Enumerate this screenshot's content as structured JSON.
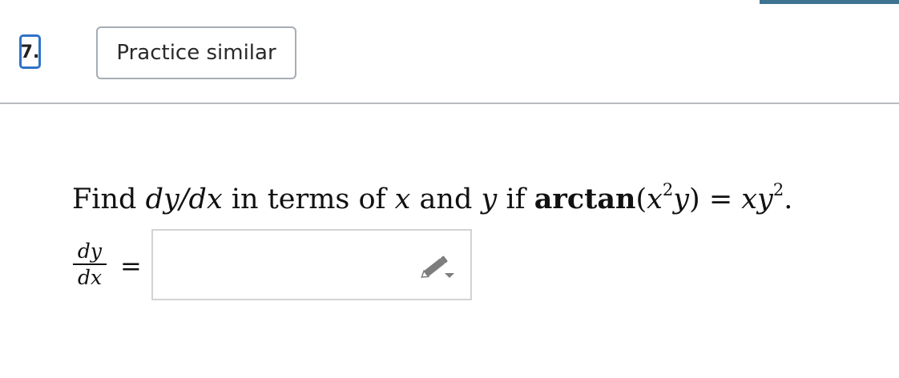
{
  "question_number": "7.",
  "practice_button_label": "Practice similar",
  "question": {
    "text_find": "Find",
    "dy_dx": "dy/dx",
    "text_in_terms_of": "in terms of",
    "var_x": "x",
    "text_and": "and",
    "var_y": "y",
    "text_if": "if",
    "func_arctan": "arctan",
    "open_paren": "(",
    "x_base": "x",
    "exponent_2": "2",
    "y_inner": "y",
    "close_paren": ")",
    "equals_sign": "=",
    "rhs": "xy",
    "rhs_exponent": "2",
    "period": "."
  },
  "answer": {
    "lhs_numerator": "dy",
    "lhs_denominator": "dx",
    "equals_sign": "=",
    "value": "",
    "placeholder": ""
  },
  "icons": {
    "editor": "pencil-dropdown-icon"
  },
  "colors": {
    "question_number_border": "#2f72c7",
    "top_accent": "#3e7391",
    "button_border": "#a7adb5",
    "divider": "#b9bcc0",
    "answer_border": "#d3d3d3",
    "pencil_icon": "#7d7d7d"
  }
}
